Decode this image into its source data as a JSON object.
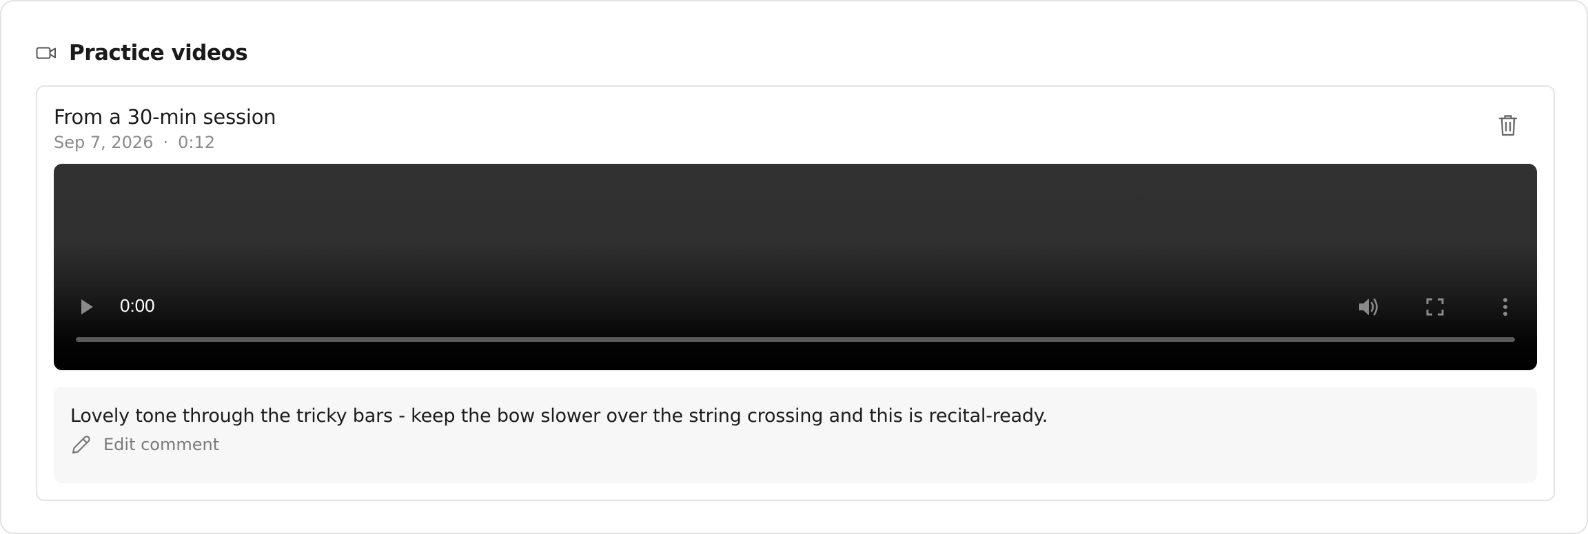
{
  "section": {
    "icon": "video-camera-icon",
    "title": "Practice videos"
  },
  "video_card": {
    "title": "From a 30-min session",
    "date": "Sep 7, 2026",
    "separator": "·",
    "duration": "0:12",
    "delete_icon": "trash-icon",
    "player": {
      "current_time": "0:00",
      "progress_fraction": 0,
      "play_icon": "play-icon",
      "mute_icon": "volume-icon",
      "fullscreen_icon": "fullscreen-icon",
      "more_icon": "more-vertical-icon"
    },
    "comment": {
      "text": "Lovely tone through the tricky bars - keep the bow slower over the string crossing and this is recital-ready.",
      "edit_label": "Edit comment",
      "edit_icon": "pencil-icon"
    }
  },
  "colors": {
    "muted_text": "#8a8a8a",
    "border": "#e3e3e3",
    "comment_bg": "#f7f7f7"
  }
}
